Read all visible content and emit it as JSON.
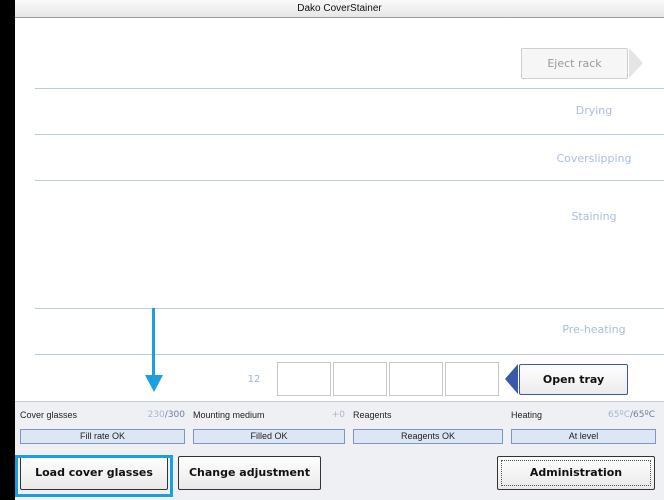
{
  "window": {
    "title": "Dako CoverStainer"
  },
  "stages": {
    "eject_rack": "Eject rack",
    "drying": "Drying",
    "coverslipping": "Coverslipping",
    "staining": "Staining",
    "pre_heating": "Pre-heating"
  },
  "tray": {
    "number": "12",
    "open_label": "Open tray"
  },
  "status": {
    "cover_glasses": {
      "label": "Cover glasses",
      "value": "230",
      "max": "/300",
      "state": "Fill rate OK"
    },
    "mounting_medium": {
      "label": "Mounting medium",
      "value": "+0",
      "state": "Filled OK"
    },
    "reagents": {
      "label": "Reagents",
      "state": "Reagents OK"
    },
    "heating": {
      "label": "Heating",
      "value": "65ºC",
      "max": "/65ºC",
      "state": "At level"
    }
  },
  "buttons": {
    "load_cover_glasses": "Load cover glasses",
    "change_adjustment": "Change adjustment",
    "administration": "Administration"
  },
  "colors": {
    "highlight": "#1aa0e0",
    "stage_label": "#a9bde0",
    "status_box": "#dde6f5"
  }
}
